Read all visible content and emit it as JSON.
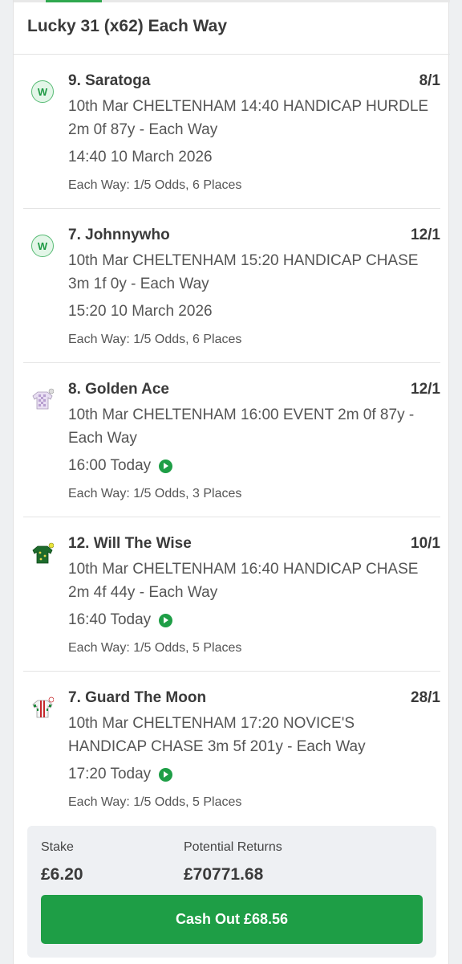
{
  "bet": {
    "title": "Lucky 31 (x62) Each Way"
  },
  "selections": [
    {
      "name": "9. Saratoga",
      "odds": "8/1",
      "description": "10th Mar CHELTENHAM 14:40 HANDICAP HURDLE 2m 0f 87y - Each Way",
      "time": "14:40 10 March 2026",
      "terms": "Each Way: 1/5 Odds, 6 Places",
      "status_icon": "W"
    },
    {
      "name": "7. Johnnywho",
      "odds": "12/1",
      "description": "10th Mar CHELTENHAM 15:20 HANDICAP CHASE 3m 1f 0y - Each Way",
      "time": "15:20 10 March 2026",
      "terms": "Each Way: 1/5 Odds, 6 Places",
      "status_icon": "W"
    },
    {
      "name": "8. Golden Ace",
      "odds": "12/1",
      "description": "10th Mar CHELTENHAM 16:00 EVENT 2m 0f 87y - Each Way",
      "time": "16:00 Today",
      "terms": "Each Way: 1/5 Odds, 3 Places",
      "icon": "jockey-silks-lilac-check-icon"
    },
    {
      "name": "12. Will The Wise",
      "odds": "10/1",
      "description": "10th Mar CHELTENHAM 16:40 HANDICAP CHASE 2m 4f 44y - Each Way",
      "time": "16:40 Today",
      "terms": "Each Way: 1/5 Odds, 5 Places",
      "icon": "jockey-silks-green-yellow-icon"
    },
    {
      "name": "7. Guard The Moon",
      "odds": "28/1",
      "description": "10th Mar CHELTENHAM 17:20 NOVICE'S HANDICAP CHASE 3m 5f 201y - Each Way",
      "time": "17:20 Today",
      "terms": "Each Way: 1/5 Odds, 5 Places",
      "icon": "jockey-silks-red-green-stripe-icon"
    }
  ],
  "summary": {
    "stake_label": "Stake",
    "stake_value": "£6.20",
    "returns_label": "Potential Returns",
    "returns_value": "£70771.68",
    "cashout_label": "Cash Out £68.56"
  },
  "colors": {
    "accent_green": "#1e9e46",
    "win_badge_bg": "#e3f6e8",
    "summary_bg": "#eef0f3"
  }
}
